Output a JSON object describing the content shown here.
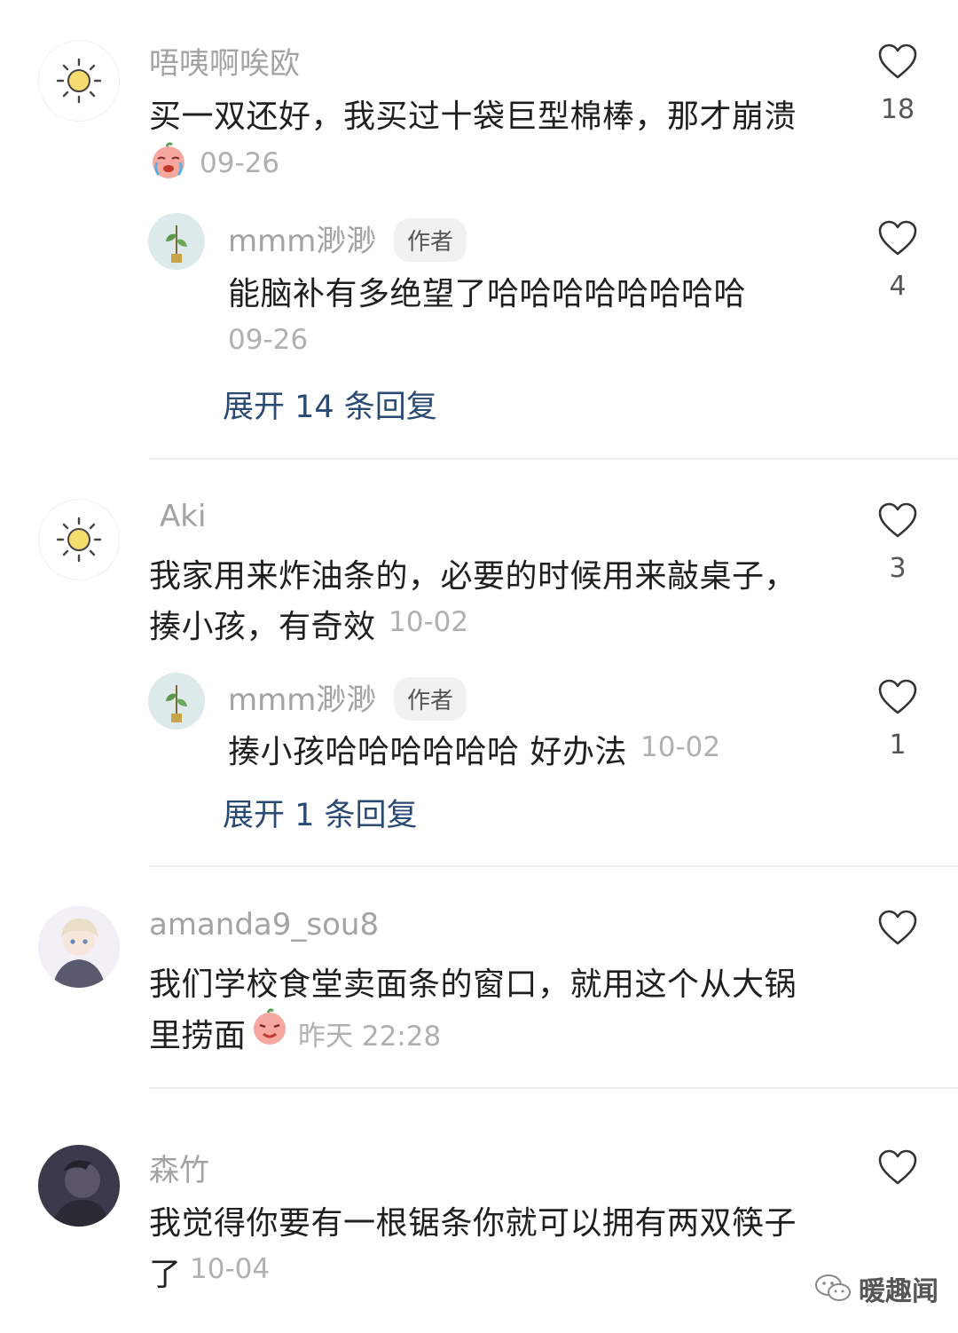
{
  "comments": [
    {
      "username": "唔咦啊唉欧",
      "text": "买一双还好，我买过十袋巨型棉棒，那才崩溃",
      "time": "09-26",
      "likes": "18",
      "avatar_icon": "sun-icon",
      "reply": {
        "username": "mmm渺渺",
        "tag": "作者",
        "text": "能脑补有多绝望了哈哈哈哈哈哈哈哈",
        "time": "09-26",
        "likes": "4",
        "avatar_icon": "plant-icon"
      },
      "expand": "展开 14 条回复"
    },
    {
      "username": "Aki",
      "text_line1": "我家用来炸油条的，必要的时候用来敲桌子，",
      "text_line2": "揍小孩，有奇效",
      "time": "10-02",
      "likes": "3",
      "avatar_icon": "sun-icon",
      "reply": {
        "username": "mmm渺渺",
        "tag": "作者",
        "text": "揍小孩哈哈哈哈哈哈 好办法",
        "time": "10-02",
        "likes": "1",
        "avatar_icon": "plant-icon"
      },
      "expand": "展开 1 条回复"
    },
    {
      "username": "amanda9_sou8",
      "text_line1": "我们学校食堂卖面条的窗口，就用这个从大锅",
      "text_line2": "里捞面",
      "time": "昨天 22:28",
      "avatar_icon": "anime-boy-icon"
    },
    {
      "username": "森竹",
      "text_line1": "我觉得你要有一根锯条你就可以拥有两双筷子",
      "text_line2": "了",
      "time": "10-04",
      "avatar_icon": "dark-portrait-icon"
    }
  ],
  "watermark": {
    "text": "暖趣闻",
    "icon": "wechat-icon"
  },
  "colors": {
    "expand_link": "#2b4a73",
    "muted": "#a3a3a3"
  }
}
